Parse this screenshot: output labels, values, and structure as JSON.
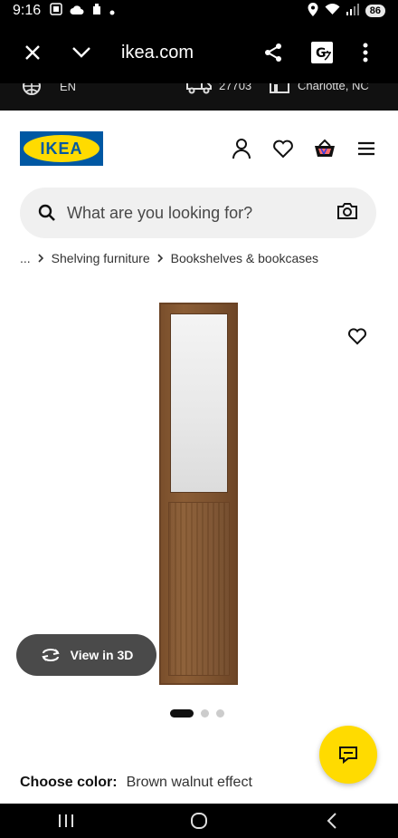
{
  "status_bar": {
    "time": "9:16",
    "battery": "86"
  },
  "browser": {
    "url": "ikea.com"
  },
  "locale": {
    "language": "EN",
    "zip": "27703",
    "store": "Charlotte, NC"
  },
  "header": {
    "logo_text": "IKEA"
  },
  "search": {
    "placeholder": "What are you looking for?"
  },
  "breadcrumb": {
    "ellipsis": "...",
    "items": [
      "Shelving furniture",
      "Bookshelves & bookcases"
    ]
  },
  "product": {
    "view3d_label": "View in 3D",
    "carousel_count": 3,
    "carousel_active": 0
  },
  "color": {
    "label": "Choose color:",
    "value": "Brown walnut effect"
  },
  "colors": {
    "ikea_blue": "#0058a3",
    "ikea_yellow": "#ffdb00"
  }
}
